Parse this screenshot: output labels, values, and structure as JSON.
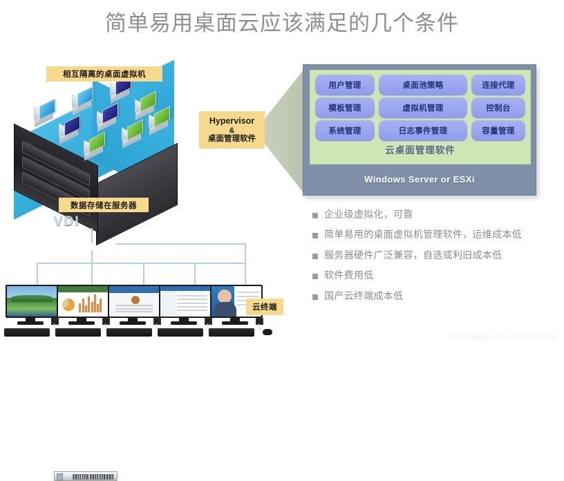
{
  "title": "简单易用桌面云应该满足的几个条件",
  "diagram": {
    "vdi": {
      "server_text": "VDI",
      "top_label": "相互隔离的桌面虚拟机",
      "bottom_label": "数据存储在服务器",
      "vm_icons": [
        {
          "name": "vm-blue-1",
          "color": "#2f9fe0"
        },
        {
          "name": "vm-navy-1",
          "color": "#21237a"
        },
        {
          "name": "vm-green-1",
          "color": "#6fc43a"
        },
        {
          "name": "vm-blue-2",
          "color": "#2f9fe0"
        },
        {
          "name": "vm-navy-2",
          "color": "#21237a"
        },
        {
          "name": "vm-green-2",
          "color": "#6fc43a"
        },
        {
          "name": "vm-navy-3",
          "color": "#21237a"
        },
        {
          "name": "vm-green-3",
          "color": "#6fc43a"
        },
        {
          "name": "vm-blue-3",
          "color": "#2f9fe0"
        }
      ]
    },
    "hypervisor": {
      "line1": "Hypervisor",
      "line2": "&",
      "line3": "桌面管理软件"
    },
    "panel": {
      "modules": [
        "用户管理",
        "桌面池策略",
        "连接代理",
        "模板管理",
        "虚拟机管理",
        "控制台",
        "系统管理",
        "日志事件管理",
        "容量管理"
      ],
      "software_caption": "云桌面管理软件",
      "os_label": "Windows Server or ESXi"
    },
    "terminal_label": "云终端",
    "terminals": [
      {
        "name": "terminal-nature",
        "screen": "s-nature"
      },
      {
        "name": "terminal-chart",
        "screen": "s-chart"
      },
      {
        "name": "terminal-web",
        "screen": "s-web"
      },
      {
        "name": "terminal-doc",
        "screen": "s-doc"
      },
      {
        "name": "terminal-video",
        "screen": "s-vid"
      }
    ]
  },
  "bullets": [
    "企业级虚拟化，可靠",
    "简单易用的桌面虚拟机管理软件，运维成本低",
    "服务器硬件广泛兼容，自选或利旧成本低",
    "软件费用低",
    "国产云终端成本低"
  ],
  "watermark": "https://blog.csdn.net/Cloudeep",
  "colors": {
    "title_gray": "#8f8f8f",
    "callout_yellow": "#f6d98a",
    "panel_slate": "#808fa8",
    "panel_green": "#cfe6b4",
    "module_blue": "#8f9ceb",
    "module_text": "#24307a",
    "bullet_gray": "#8c8c8c",
    "vdi_top_blue": "#37b0df",
    "link_line": "#b4cfe3"
  }
}
